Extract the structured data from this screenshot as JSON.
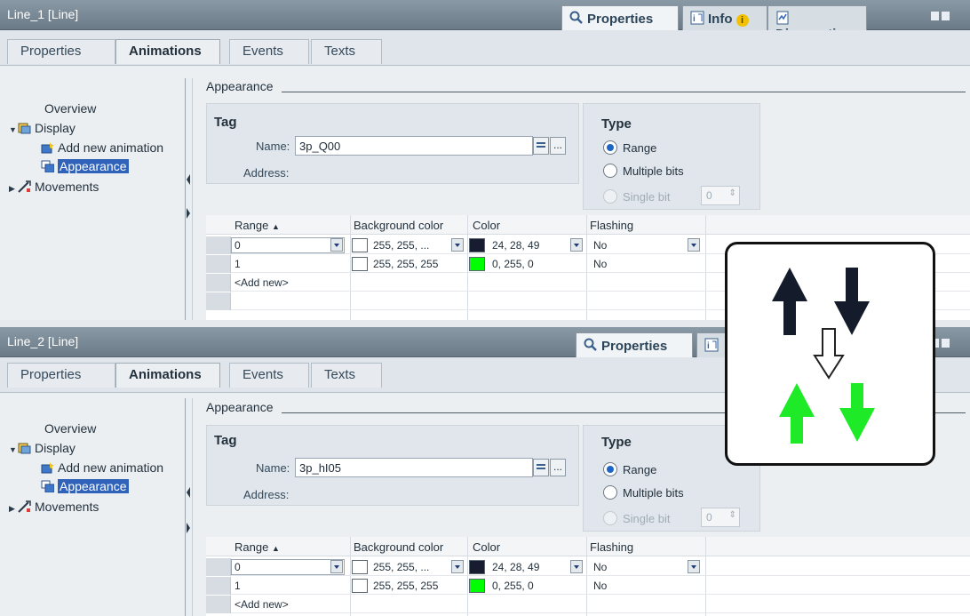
{
  "panels": [
    {
      "title": "Line_1 [Line]",
      "inspector_tabs": {
        "properties": "Properties",
        "info": "Info",
        "diagnostics": "Diagnostics"
      },
      "subtabs": [
        "Properties",
        "Animations",
        "Events",
        "Texts"
      ],
      "nav": {
        "overview": "Overview",
        "display": "Display",
        "add_new_animation": "Add new animation",
        "appearance": "Appearance",
        "movements": "Movements"
      },
      "section_title": "Appearance",
      "tag": {
        "title": "Tag",
        "name_label": "Name:",
        "name_value": "3p_Q00",
        "address_label": "Address:",
        "browse_button": "..."
      },
      "type": {
        "title": "Type",
        "range": "Range",
        "multiple_bits": "Multiple bits",
        "single_bit": "Single bit",
        "bit_value": "0",
        "selected": "Range"
      },
      "table": {
        "headers": [
          "Range",
          "Background color",
          "Color",
          "Flashing"
        ],
        "rows": [
          {
            "range": "0",
            "bg_text": "255, 255, ...",
            "bg_color": "#ffffff",
            "color_text": "24, 28, 49",
            "color_swatch": "#181c31",
            "flashing": "No"
          },
          {
            "range": "1",
            "bg_text": "255, 255, 255",
            "bg_color": "#ffffff",
            "color_text": "0, 255, 0",
            "color_swatch": "#00ff00",
            "flashing": "No"
          }
        ],
        "add_new": "<Add new>"
      }
    },
    {
      "title": "Line_2 [Line]",
      "inspector_tabs": {
        "properties": "Properties"
      },
      "subtabs": [
        "Properties",
        "Animations",
        "Events",
        "Texts"
      ],
      "nav": {
        "overview": "Overview",
        "display": "Display",
        "add_new_animation": "Add new animation",
        "appearance": "Appearance",
        "movements": "Movements"
      },
      "section_title": "Appearance",
      "tag": {
        "title": "Tag",
        "name_label": "Name:",
        "name_value": "3p_hI05",
        "address_label": "Address:",
        "browse_button": "..."
      },
      "type": {
        "title": "Type",
        "range": "Range",
        "multiple_bits": "Multiple bits",
        "single_bit": "Single bit",
        "bit_value": "0",
        "selected": "Range"
      },
      "table": {
        "headers": [
          "Range",
          "Background color",
          "Color",
          "Flashing"
        ],
        "rows": [
          {
            "range": "0",
            "bg_text": "255, 255, ...",
            "bg_color": "#ffffff",
            "color_text": "24, 28, 49",
            "color_swatch": "#181c31",
            "flashing": "No"
          },
          {
            "range": "1",
            "bg_text": "255, 255, 255",
            "bg_color": "#ffffff",
            "color_text": "0, 255, 0",
            "color_swatch": "#00ff00",
            "flashing": "No"
          }
        ],
        "add_new": "<Add new>"
      }
    }
  ],
  "callout": {
    "top_arrows_color": "#141c2c",
    "bottom_arrows_color": "#1eea28",
    "transition_arrow": "down-outline-arrow"
  },
  "colors": {
    "titlebar": "#7a8996",
    "selection": "#2f62b8",
    "radio_selected": "#1d66c6"
  }
}
